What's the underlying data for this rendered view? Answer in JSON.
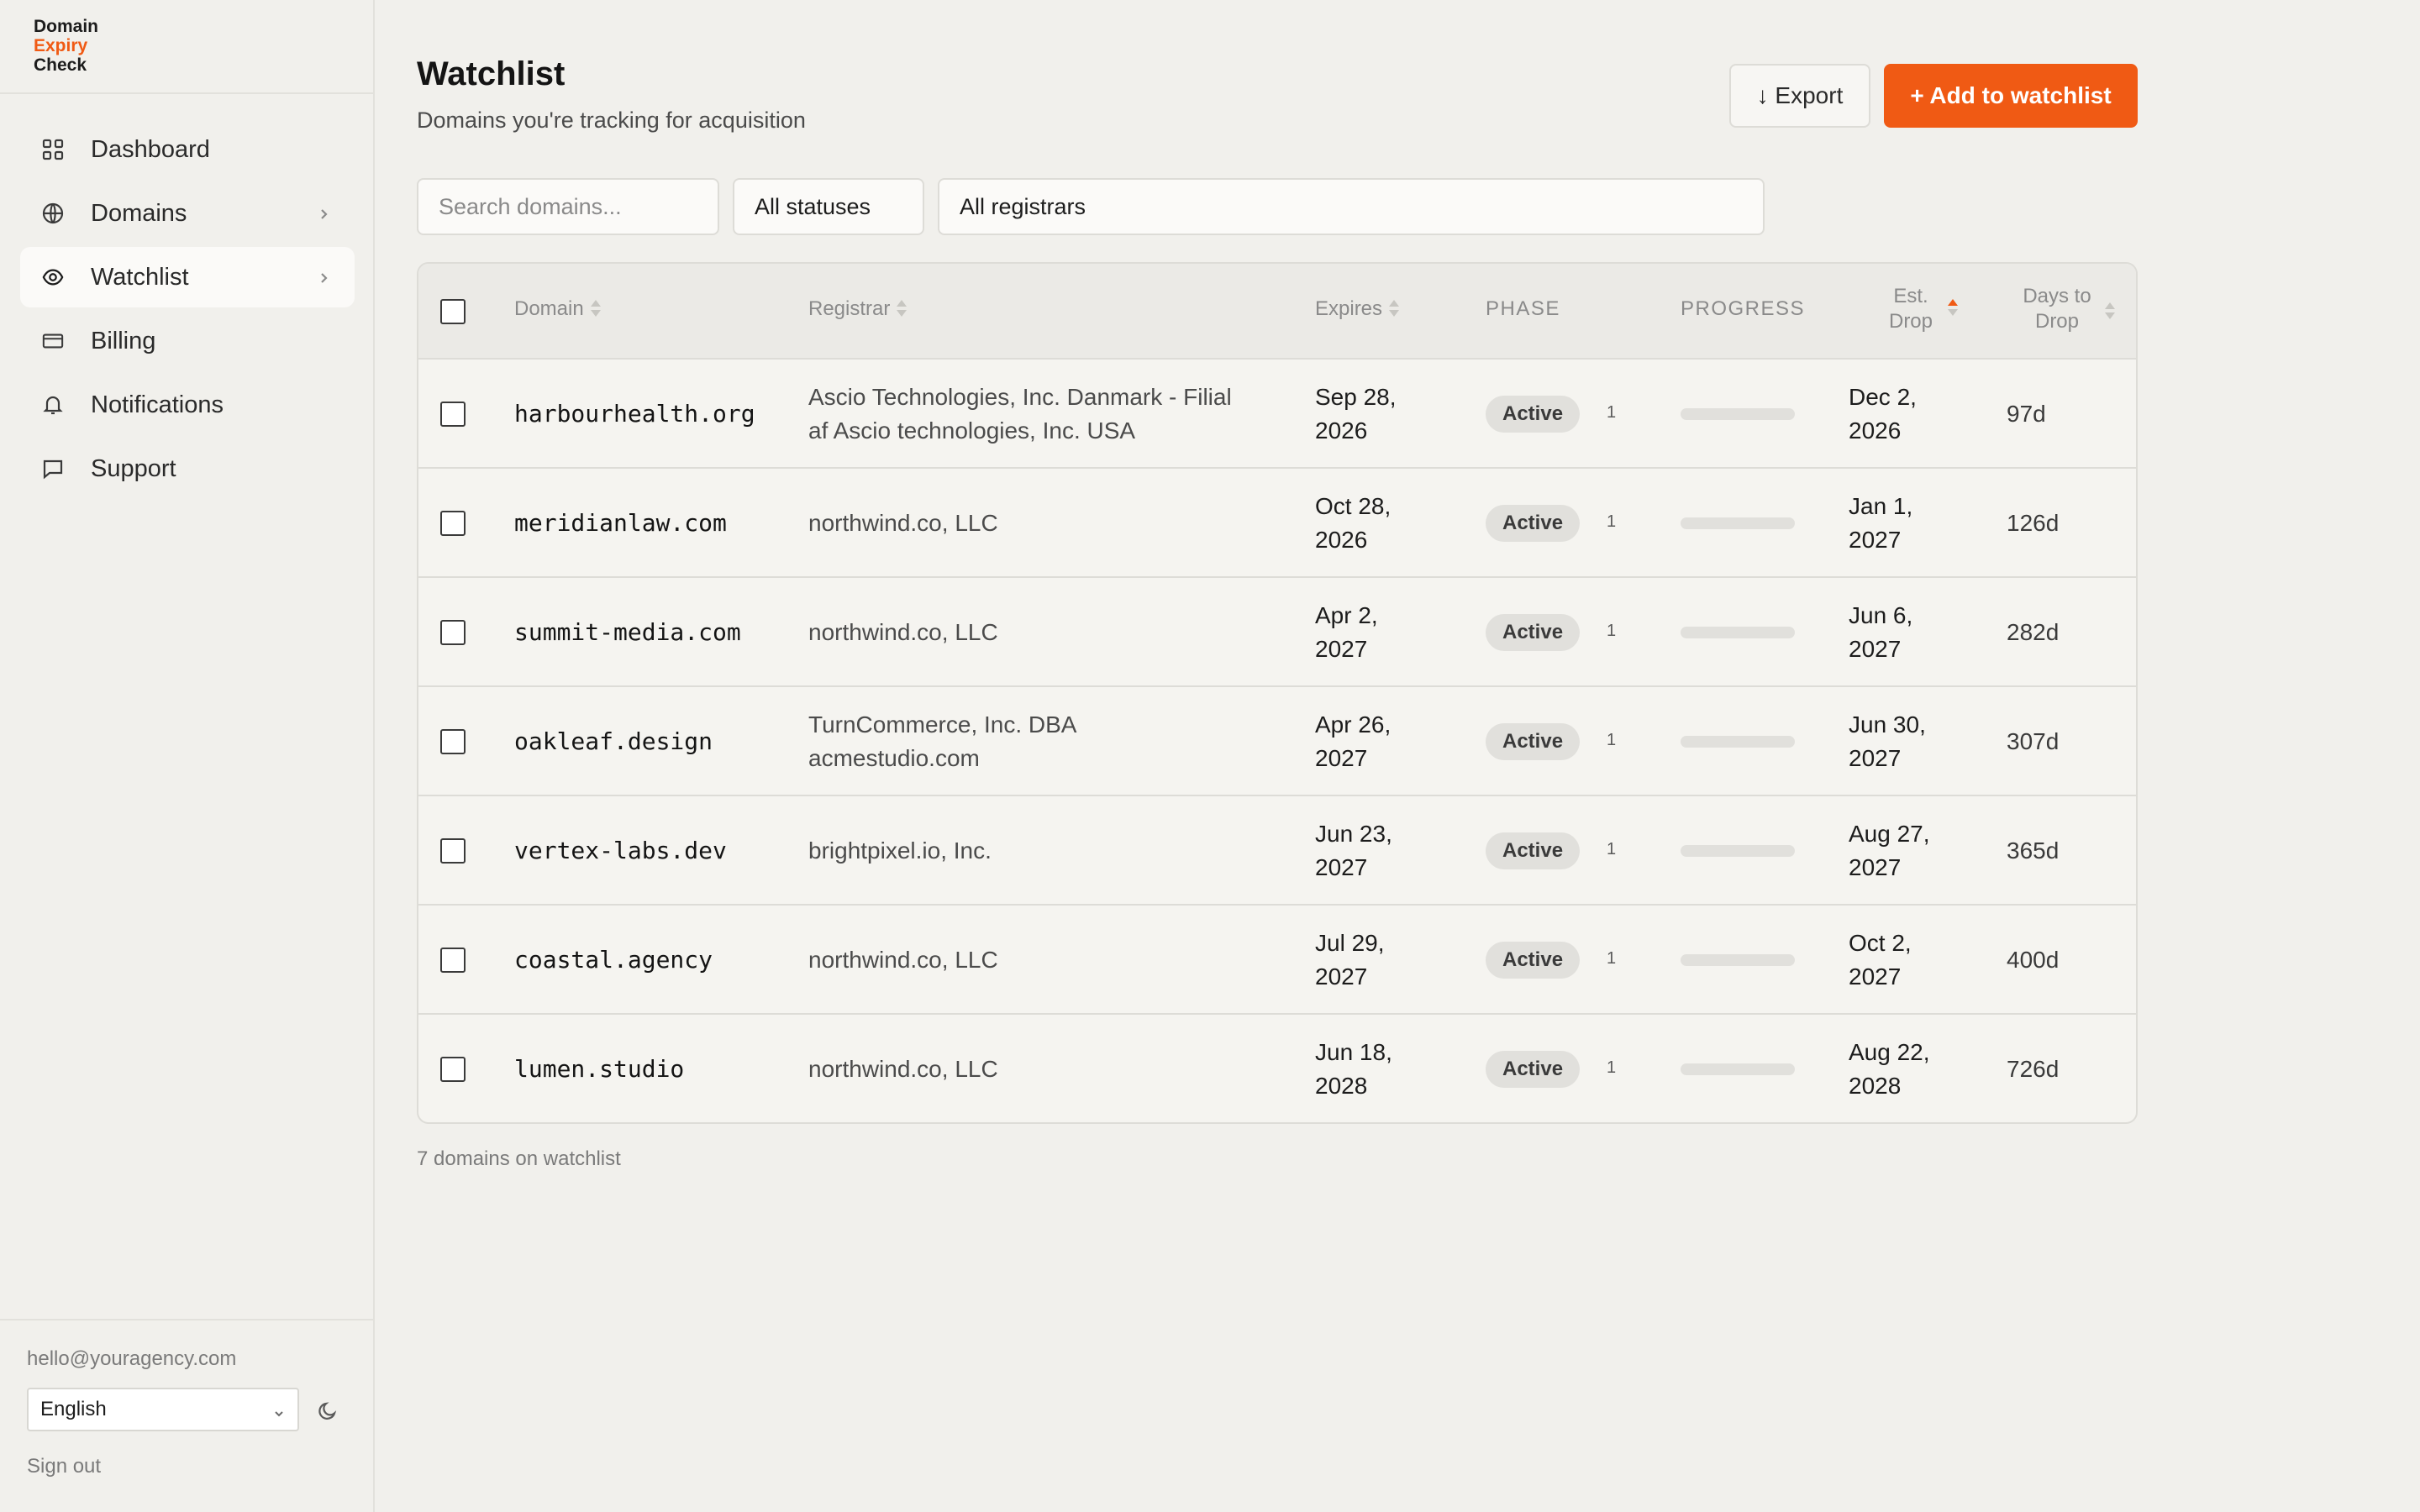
{
  "app": {
    "logo_line1": "Domain",
    "logo_line2": "Expiry",
    "logo_line3": "Check",
    "accent_color": "#f05a14"
  },
  "sidebar": {
    "items": [
      {
        "label": "Dashboard",
        "icon": "grid-icon",
        "active": false,
        "chevron": false
      },
      {
        "label": "Domains",
        "icon": "globe-icon",
        "active": false,
        "chevron": true
      },
      {
        "label": "Watchlist",
        "icon": "eye-icon",
        "active": true,
        "chevron": true
      },
      {
        "label": "Billing",
        "icon": "credit-card-icon",
        "active": false,
        "chevron": false
      },
      {
        "label": "Notifications",
        "icon": "bell-icon",
        "active": false,
        "chevron": false
      },
      {
        "label": "Support",
        "icon": "chat-icon",
        "active": false,
        "chevron": false
      }
    ],
    "user_email": "hello@youragency.com",
    "language": "English",
    "sign_out": "Sign out"
  },
  "header": {
    "title": "Watchlist",
    "subtitle": "Domains you're tracking for acquisition",
    "export_label": "↓ Export",
    "add_label": "+ Add to watchlist"
  },
  "filters": {
    "search_placeholder": "Search domains...",
    "status": "All statuses",
    "registrar": "All registrars"
  },
  "table": {
    "columns": {
      "domain": "Domain",
      "registrar": "Registrar",
      "expires": "Expires",
      "phase": "PHASE",
      "progress": "PROGRESS",
      "est_drop_1": "Est.",
      "est_drop_2": "Drop",
      "days_1": "Days to",
      "days_2": "Drop"
    },
    "rows": [
      {
        "domain": "harbourhealth.org",
        "registrar_1": "Ascio Technologies, Inc. Danmark - Filial",
        "registrar_2": "af Ascio technologies, Inc. USA",
        "expires_1": "Sep 28,",
        "expires_2": "2026",
        "phase": "Active",
        "phase_num": "1",
        "progress": 0,
        "drop_1": "Dec 2,",
        "drop_2": "2026",
        "days": "97d"
      },
      {
        "domain": "meridianlaw.com",
        "registrar_1": "northwind.co, LLC",
        "registrar_2": "",
        "expires_1": "Oct 28,",
        "expires_2": "2026",
        "phase": "Active",
        "phase_num": "1",
        "progress": 0,
        "drop_1": "Jan 1,",
        "drop_2": "2027",
        "days": "126d"
      },
      {
        "domain": "summit-media.com",
        "registrar_1": "northwind.co, LLC",
        "registrar_2": "",
        "expires_1": "Apr 2,",
        "expires_2": "2027",
        "phase": "Active",
        "phase_num": "1",
        "progress": 0,
        "drop_1": "Jun 6,",
        "drop_2": "2027",
        "days": "282d"
      },
      {
        "domain": "oakleaf.design",
        "registrar_1": "TurnCommerce, Inc. DBA",
        "registrar_2": "acmestudio.com",
        "expires_1": "Apr 26,",
        "expires_2": "2027",
        "phase": "Active",
        "phase_num": "1",
        "progress": 0,
        "drop_1": "Jun 30,",
        "drop_2": "2027",
        "days": "307d"
      },
      {
        "domain": "vertex-labs.dev",
        "registrar_1": "brightpixel.io, Inc.",
        "registrar_2": "",
        "expires_1": "Jun 23,",
        "expires_2": "2027",
        "phase": "Active",
        "phase_num": "1",
        "progress": 0,
        "drop_1": "Aug 27,",
        "drop_2": "2027",
        "days": "365d"
      },
      {
        "domain": "coastal.agency",
        "registrar_1": "northwind.co, LLC",
        "registrar_2": "",
        "expires_1": "Jul 29,",
        "expires_2": "2027",
        "phase": "Active",
        "phase_num": "1",
        "progress": 0,
        "drop_1": "Oct 2,",
        "drop_2": "2027",
        "days": "400d"
      },
      {
        "domain": "lumen.studio",
        "registrar_1": "northwind.co, LLC",
        "registrar_2": "",
        "expires_1": "Jun 18,",
        "expires_2": "2028",
        "phase": "Active",
        "phase_num": "1",
        "progress": 0,
        "drop_1": "Aug 22,",
        "drop_2": "2028",
        "days": "726d"
      }
    ],
    "footer": "7 domains on watchlist"
  }
}
